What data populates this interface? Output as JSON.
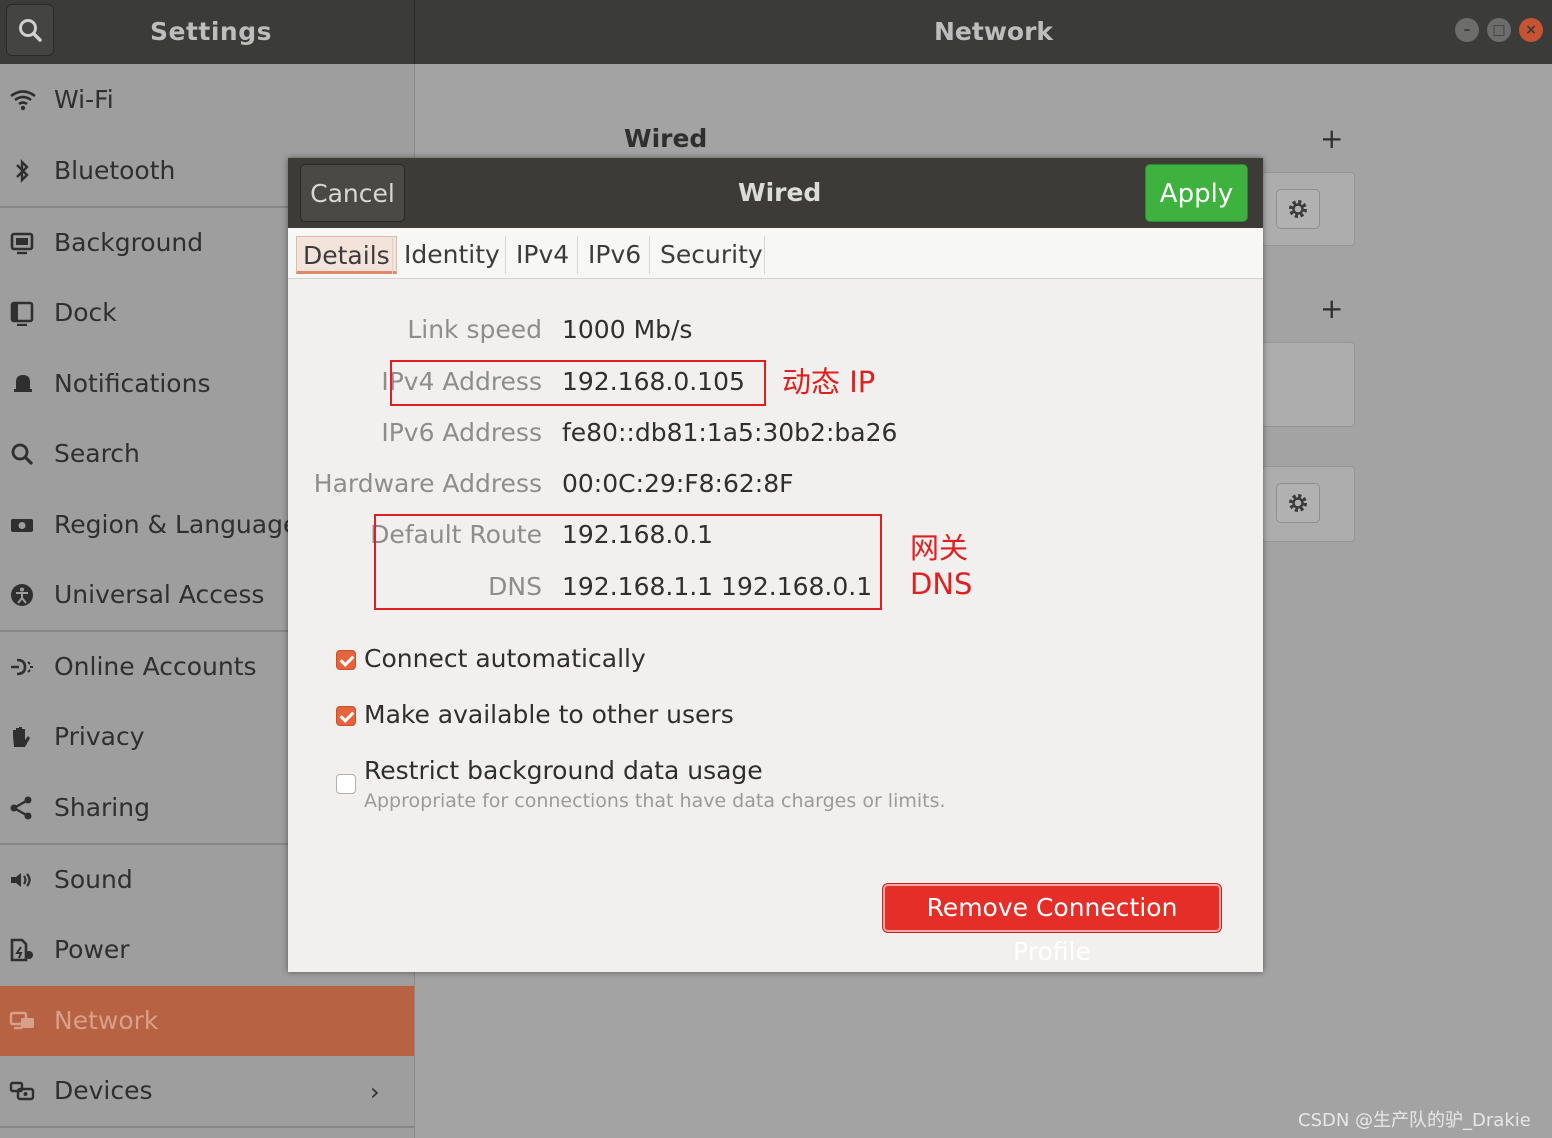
{
  "header": {
    "left_title": "Settings",
    "right_title": "Network"
  },
  "sidebar": {
    "items": [
      {
        "label": "Wi-Fi",
        "icon": "wifi-icon"
      },
      {
        "label": "Bluetooth",
        "icon": "bluetooth-icon"
      },
      {
        "label": "Background",
        "icon": "background-icon"
      },
      {
        "label": "Dock",
        "icon": "dock-icon"
      },
      {
        "label": "Notifications",
        "icon": "bell-icon"
      },
      {
        "label": "Search",
        "icon": "search-icon"
      },
      {
        "label": "Region & Language",
        "icon": "region-icon"
      },
      {
        "label": "Universal Access",
        "icon": "accessibility-icon"
      },
      {
        "label": "Online Accounts",
        "icon": "online-accounts-icon"
      },
      {
        "label": "Privacy",
        "icon": "hand-icon"
      },
      {
        "label": "Sharing",
        "icon": "share-icon"
      },
      {
        "label": "Sound",
        "icon": "speaker-icon"
      },
      {
        "label": "Power",
        "icon": "power-icon"
      },
      {
        "label": "Network",
        "icon": "network-icon",
        "active": true
      },
      {
        "label": "Devices",
        "icon": "devices-icon"
      }
    ],
    "devices_chevron": "›"
  },
  "main": {
    "wired_heading": "Wired",
    "add_symbol": "+"
  },
  "dialog": {
    "title": "Wired",
    "cancel_label": "Cancel",
    "apply_label": "Apply",
    "tabs": [
      "Details",
      "Identity",
      "IPv4",
      "IPv6",
      "Security"
    ],
    "details": {
      "link_speed_label": "Link speed",
      "link_speed_value": "1000 Mb/s",
      "ipv4_label": "IPv4 Address",
      "ipv4_value": "192.168.0.105",
      "ipv6_label": "IPv6 Address",
      "ipv6_value": "fe80::db81:1a5:30b2:ba26",
      "hw_label": "Hardware Address",
      "hw_value": "00:0C:29:F8:62:8F",
      "route_label": "Default Route",
      "route_value": "192.168.0.1",
      "dns_label": "DNS",
      "dns_value": "192.168.1.1 192.168.0.1"
    },
    "checks": {
      "auto_connect": {
        "label": "Connect automatically",
        "checked": true
      },
      "available_all": {
        "label": "Make available to other users",
        "checked": true
      },
      "restrict_bg": {
        "label": "Restrict background data usage",
        "sub": "Appropriate for connections that have data charges or limits.",
        "checked": false
      }
    },
    "remove_label": "Remove Connection Profile"
  },
  "annotations": {
    "ip_note": "动态 IP",
    "gateway_note": "网关",
    "dns_note": "DNS"
  },
  "watermark": "CSDN @生产队的驴_Drakie",
  "colors": {
    "accent": "#e5643c",
    "active_sidebar": "#b86244",
    "apply_green": "#3eb13f",
    "destructive_red": "#e42e27",
    "annotation_red": "#e02020"
  }
}
